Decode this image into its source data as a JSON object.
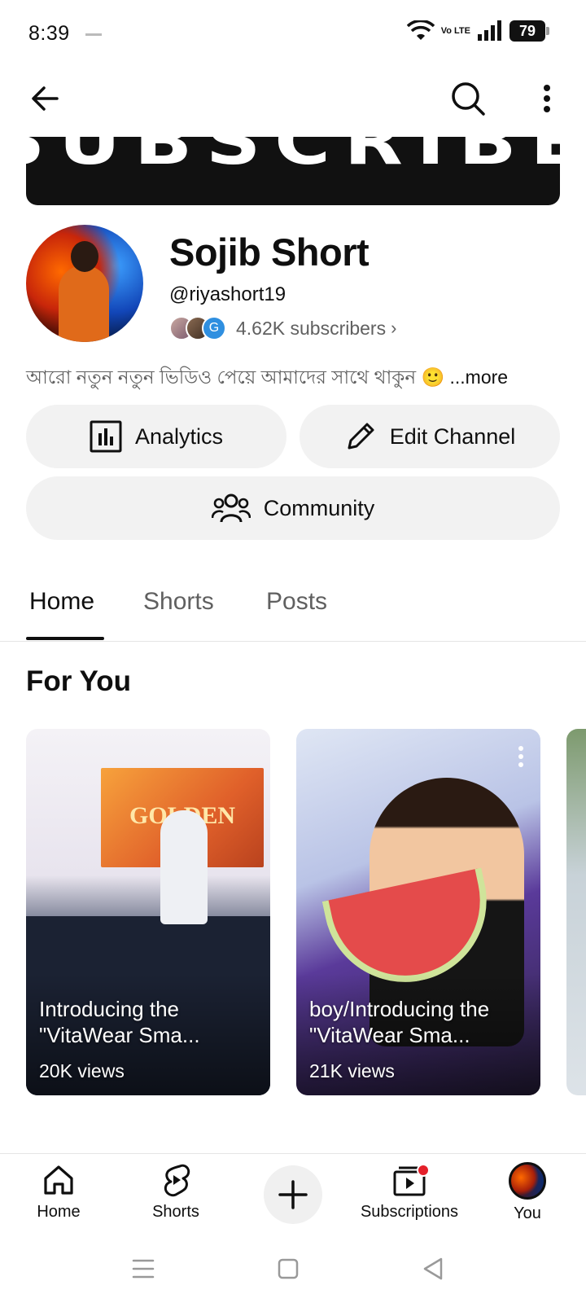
{
  "status_bar": {
    "time": "8:39",
    "network": "Vo LTE",
    "battery": "79"
  },
  "top_bar": {
    "back_icon": "arrow-left-icon",
    "search_icon": "search-icon",
    "more_icon": "more-vertical-icon"
  },
  "banner": {
    "text": "SUBSCRIBE"
  },
  "channel": {
    "name": "Sojib Short",
    "handle": "@riyashort19",
    "subscribers": "4.62K subscribers",
    "subscriber_avatar_letter": "G",
    "description": "আরো নতুন নতুন ভিডিও পেয়ে আমাদের সাথে থাকুন 🙂",
    "more_label": "...more"
  },
  "actions": {
    "analytics_label": "Analytics",
    "edit_label": "Edit Channel",
    "community_label": "Community"
  },
  "tabs": [
    {
      "label": "Home",
      "active": true
    },
    {
      "label": "Shorts",
      "active": false
    },
    {
      "label": "Posts",
      "active": false
    }
  ],
  "section": {
    "title": "For You"
  },
  "cards": [
    {
      "title": "Introducing the \"VitaWear Sma...",
      "views": "20K views",
      "poster_text": "GOLDEN"
    },
    {
      "title": "boy/Introducing the \"VitaWear Sma...",
      "views": "21K views"
    }
  ],
  "bottom_nav": {
    "home": "Home",
    "shorts": "Shorts",
    "subscriptions": "Subscriptions",
    "you": "You"
  },
  "colors": {
    "accent_red": "#e4202a",
    "pill_bg": "#f2f2f2",
    "secondary_text": "#606060"
  }
}
